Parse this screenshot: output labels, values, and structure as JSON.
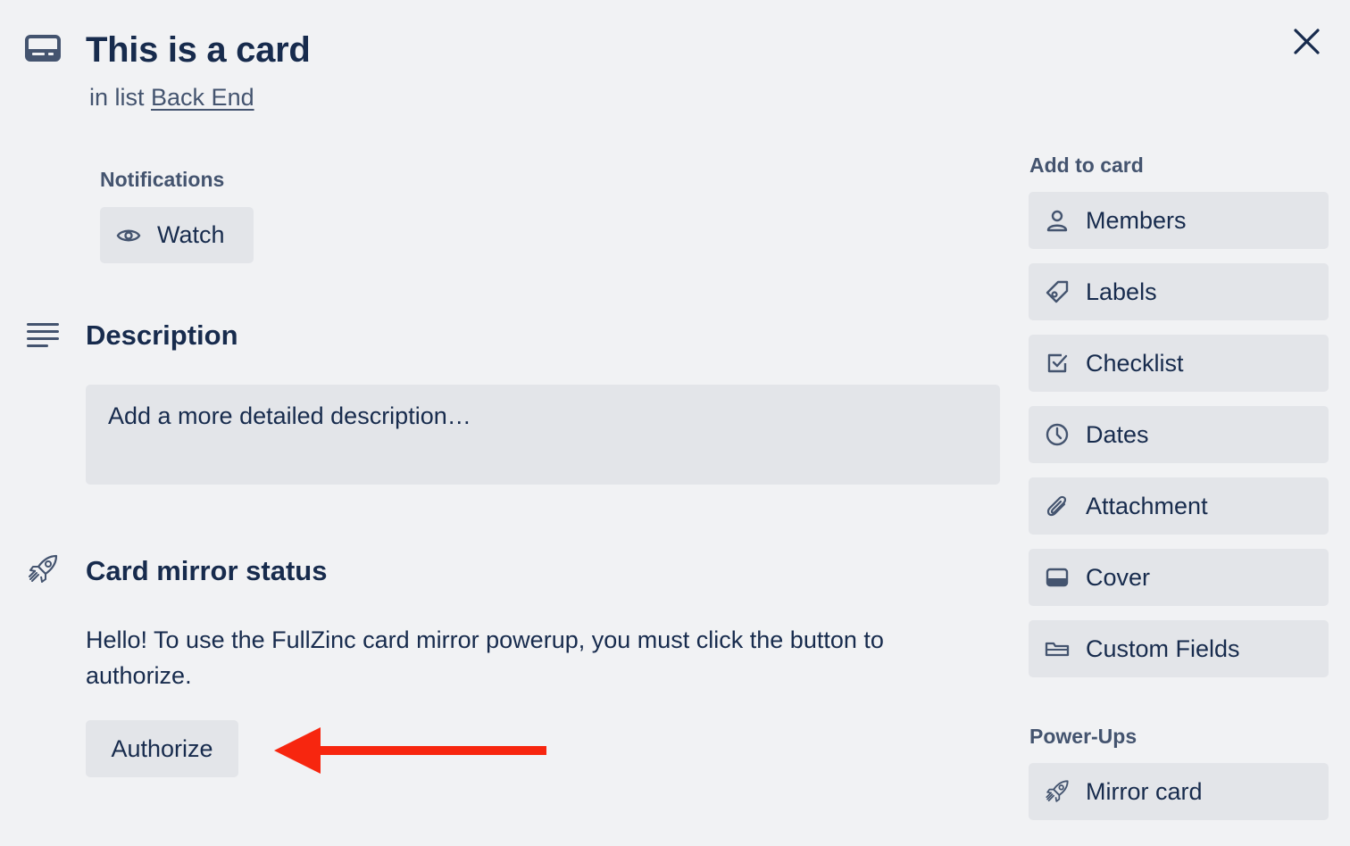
{
  "card": {
    "title": "This is a card",
    "list_prefix": "in list",
    "list_name": "Back End"
  },
  "notifications": {
    "label": "Notifications",
    "watch_label": "Watch"
  },
  "description": {
    "title": "Description",
    "placeholder": "Add a more detailed description…"
  },
  "mirror": {
    "title": "Card mirror status",
    "message": "Hello! To use the FullZinc card mirror powerup, you must click the button to authorize.",
    "authorize_label": "Authorize"
  },
  "sidebar": {
    "add_label": "Add to card",
    "items": [
      {
        "label": "Members",
        "icon": "person-icon"
      },
      {
        "label": "Labels",
        "icon": "tag-icon"
      },
      {
        "label": "Checklist",
        "icon": "checkbox-icon"
      },
      {
        "label": "Dates",
        "icon": "clock-icon"
      },
      {
        "label": "Attachment",
        "icon": "paperclip-icon"
      },
      {
        "label": "Cover",
        "icon": "cover-icon"
      },
      {
        "label": "Custom Fields",
        "icon": "custom-fields-icon"
      }
    ],
    "powerups_label": "Power-Ups",
    "powerups": [
      {
        "label": "Mirror card",
        "icon": "rocket-icon"
      }
    ]
  },
  "colors": {
    "background": "#f1f2f4",
    "button": "#e3e5e9",
    "text": "#172b4d",
    "subtle_text": "#44546f",
    "annotation_arrow": "#f7260f"
  }
}
